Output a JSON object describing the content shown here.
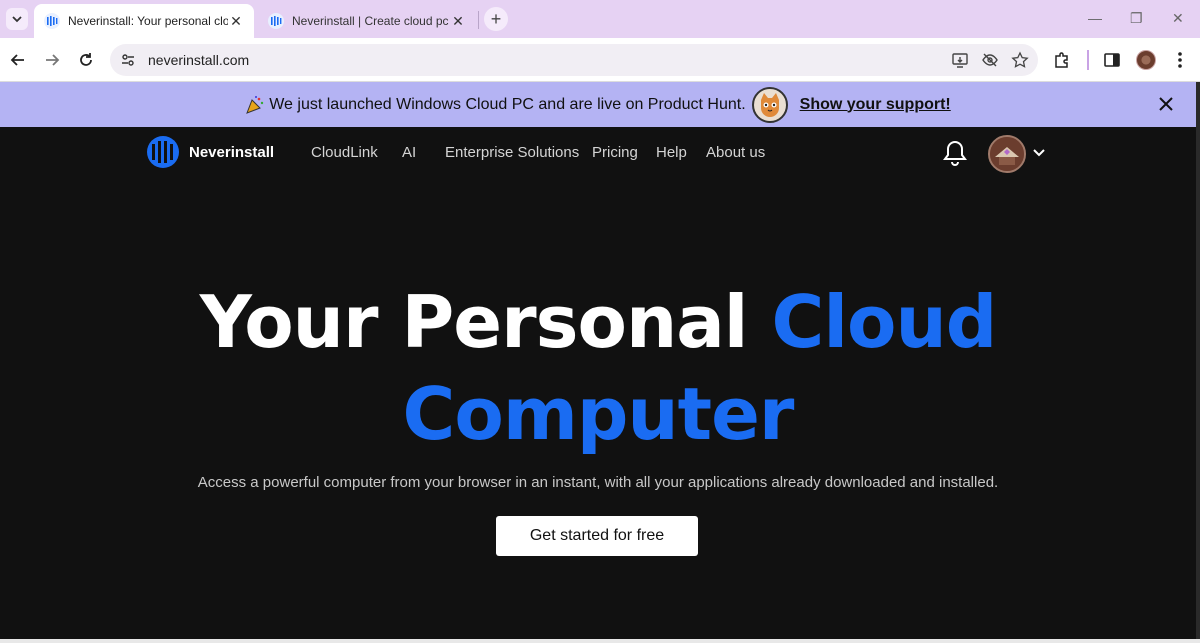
{
  "browser": {
    "tabs": [
      {
        "title": "Neverinstall: Your personal clou",
        "active": true
      },
      {
        "title": "Neverinstall | Create cloud pc sp",
        "active": false
      }
    ],
    "new_tab": "+",
    "window_controls": {
      "minimize": "—",
      "restore": "❐",
      "close": "✕"
    },
    "url": "neverinstall.com"
  },
  "banner": {
    "message": "We just launched Windows Cloud PC and are live on Product Hunt.",
    "link": "Show your support!"
  },
  "nav": {
    "brand": "Neverinstall",
    "links": [
      "CloudLink",
      "AI",
      "Enterprise Solutions",
      "Pricing",
      "Help",
      "About us"
    ]
  },
  "hero": {
    "title_part1": "Your Personal ",
    "title_accent1": "Cloud",
    "title_accent2": "Computer",
    "subtitle": "Access a powerful computer from your browser in an instant, with all your applications already downloaded and installed.",
    "cta": "Get started for free"
  },
  "colors": {
    "accent": "#1a6cf2",
    "banner_bg": "#b4b3f3",
    "page_bg": "#111111",
    "tabbar_bg": "#e6d2f3"
  }
}
